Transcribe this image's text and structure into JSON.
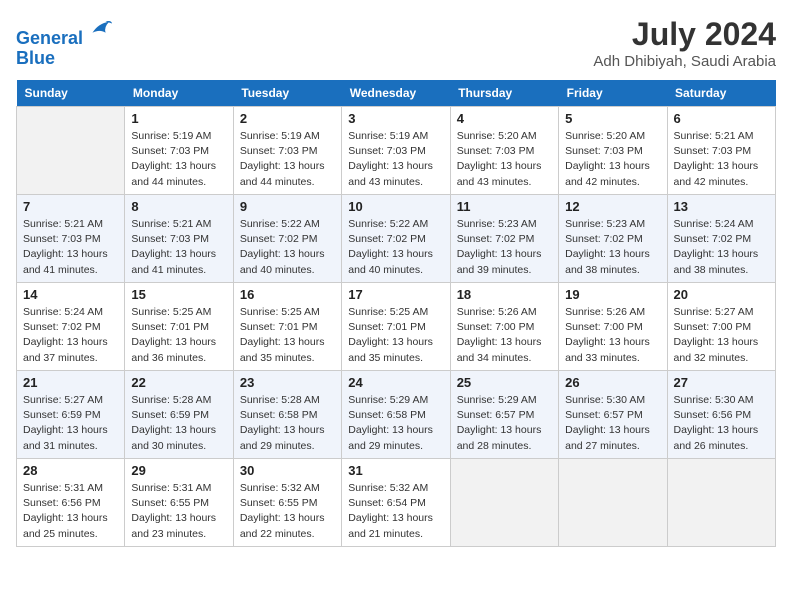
{
  "header": {
    "logo_line1": "General",
    "logo_line2": "Blue",
    "month_year": "July 2024",
    "location": "Adh Dhibiyah, Saudi Arabia"
  },
  "weekdays": [
    "Sunday",
    "Monday",
    "Tuesday",
    "Wednesday",
    "Thursday",
    "Friday",
    "Saturday"
  ],
  "weeks": [
    [
      {
        "day": "",
        "empty": true
      },
      {
        "day": "1",
        "sunrise": "5:19 AM",
        "sunset": "7:03 PM",
        "daylight": "13 hours and 44 minutes."
      },
      {
        "day": "2",
        "sunrise": "5:19 AM",
        "sunset": "7:03 PM",
        "daylight": "13 hours and 44 minutes."
      },
      {
        "day": "3",
        "sunrise": "5:19 AM",
        "sunset": "7:03 PM",
        "daylight": "13 hours and 43 minutes."
      },
      {
        "day": "4",
        "sunrise": "5:20 AM",
        "sunset": "7:03 PM",
        "daylight": "13 hours and 43 minutes."
      },
      {
        "day": "5",
        "sunrise": "5:20 AM",
        "sunset": "7:03 PM",
        "daylight": "13 hours and 42 minutes."
      },
      {
        "day": "6",
        "sunrise": "5:21 AM",
        "sunset": "7:03 PM",
        "daylight": "13 hours and 42 minutes."
      }
    ],
    [
      {
        "day": "7",
        "sunrise": "5:21 AM",
        "sunset": "7:03 PM",
        "daylight": "13 hours and 41 minutes."
      },
      {
        "day": "8",
        "sunrise": "5:21 AM",
        "sunset": "7:03 PM",
        "daylight": "13 hours and 41 minutes."
      },
      {
        "day": "9",
        "sunrise": "5:22 AM",
        "sunset": "7:02 PM",
        "daylight": "13 hours and 40 minutes."
      },
      {
        "day": "10",
        "sunrise": "5:22 AM",
        "sunset": "7:02 PM",
        "daylight": "13 hours and 40 minutes."
      },
      {
        "day": "11",
        "sunrise": "5:23 AM",
        "sunset": "7:02 PM",
        "daylight": "13 hours and 39 minutes."
      },
      {
        "day": "12",
        "sunrise": "5:23 AM",
        "sunset": "7:02 PM",
        "daylight": "13 hours and 38 minutes."
      },
      {
        "day": "13",
        "sunrise": "5:24 AM",
        "sunset": "7:02 PM",
        "daylight": "13 hours and 38 minutes."
      }
    ],
    [
      {
        "day": "14",
        "sunrise": "5:24 AM",
        "sunset": "7:02 PM",
        "daylight": "13 hours and 37 minutes."
      },
      {
        "day": "15",
        "sunrise": "5:25 AM",
        "sunset": "7:01 PM",
        "daylight": "13 hours and 36 minutes."
      },
      {
        "day": "16",
        "sunrise": "5:25 AM",
        "sunset": "7:01 PM",
        "daylight": "13 hours and 35 minutes."
      },
      {
        "day": "17",
        "sunrise": "5:25 AM",
        "sunset": "7:01 PM",
        "daylight": "13 hours and 35 minutes."
      },
      {
        "day": "18",
        "sunrise": "5:26 AM",
        "sunset": "7:00 PM",
        "daylight": "13 hours and 34 minutes."
      },
      {
        "day": "19",
        "sunrise": "5:26 AM",
        "sunset": "7:00 PM",
        "daylight": "13 hours and 33 minutes."
      },
      {
        "day": "20",
        "sunrise": "5:27 AM",
        "sunset": "7:00 PM",
        "daylight": "13 hours and 32 minutes."
      }
    ],
    [
      {
        "day": "21",
        "sunrise": "5:27 AM",
        "sunset": "6:59 PM",
        "daylight": "13 hours and 31 minutes."
      },
      {
        "day": "22",
        "sunrise": "5:28 AM",
        "sunset": "6:59 PM",
        "daylight": "13 hours and 30 minutes."
      },
      {
        "day": "23",
        "sunrise": "5:28 AM",
        "sunset": "6:58 PM",
        "daylight": "13 hours and 29 minutes."
      },
      {
        "day": "24",
        "sunrise": "5:29 AM",
        "sunset": "6:58 PM",
        "daylight": "13 hours and 29 minutes."
      },
      {
        "day": "25",
        "sunrise": "5:29 AM",
        "sunset": "6:57 PM",
        "daylight": "13 hours and 28 minutes."
      },
      {
        "day": "26",
        "sunrise": "5:30 AM",
        "sunset": "6:57 PM",
        "daylight": "13 hours and 27 minutes."
      },
      {
        "day": "27",
        "sunrise": "5:30 AM",
        "sunset": "6:56 PM",
        "daylight": "13 hours and 26 minutes."
      }
    ],
    [
      {
        "day": "28",
        "sunrise": "5:31 AM",
        "sunset": "6:56 PM",
        "daylight": "13 hours and 25 minutes."
      },
      {
        "day": "29",
        "sunrise": "5:31 AM",
        "sunset": "6:55 PM",
        "daylight": "13 hours and 23 minutes."
      },
      {
        "day": "30",
        "sunrise": "5:32 AM",
        "sunset": "6:55 PM",
        "daylight": "13 hours and 22 minutes."
      },
      {
        "day": "31",
        "sunrise": "5:32 AM",
        "sunset": "6:54 PM",
        "daylight": "13 hours and 21 minutes."
      },
      {
        "day": "",
        "empty": true
      },
      {
        "day": "",
        "empty": true
      },
      {
        "day": "",
        "empty": true
      }
    ]
  ]
}
